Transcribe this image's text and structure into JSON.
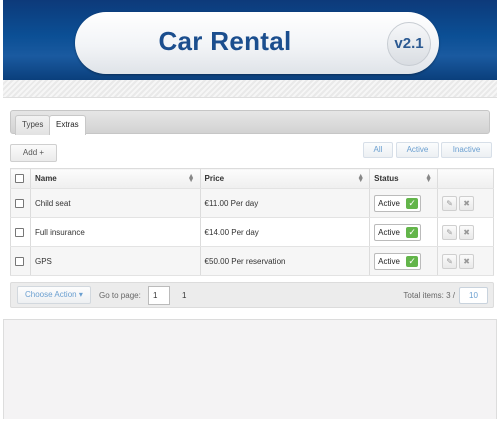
{
  "header": {
    "title": "Car Rental",
    "version": "v2.1"
  },
  "tabs": [
    {
      "label": "Types",
      "active": false
    },
    {
      "label": "Extras",
      "active": true
    }
  ],
  "toolbar": {
    "add_label": "Add +",
    "filters": [
      "All",
      "Active",
      "Inactive"
    ]
  },
  "table": {
    "columns": [
      "Name",
      "Price",
      "Status"
    ],
    "rows": [
      {
        "name": "Child seat",
        "price": "€11.00 Per day",
        "status": "Active"
      },
      {
        "name": "Full insurance",
        "price": "€14.00 Per day",
        "status": "Active"
      },
      {
        "name": "GPS",
        "price": "€50.00 Per reservation",
        "status": "Active"
      }
    ]
  },
  "footer": {
    "choose_action": "Choose Action",
    "goto_label": "Go to page:",
    "page_value": "1",
    "page_count": "1",
    "total_label": "Total items: 3 /",
    "per_page": "10"
  },
  "colors": {
    "header_blue": "#0b4f95",
    "title_blue": "#1b4e8e",
    "active_green": "#63b54a",
    "link_blue": "#6a9fd0"
  }
}
